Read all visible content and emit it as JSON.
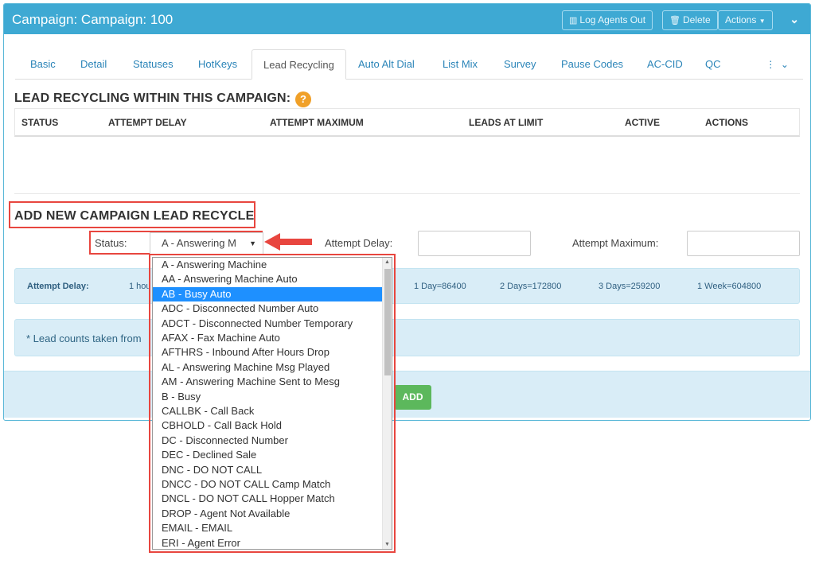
{
  "header": {
    "title": "Campaign: Campaign: 100",
    "log_agents_out": "Log Agents Out",
    "delete": "Delete",
    "actions": "Actions",
    "accent_color": "#3ea9d3"
  },
  "tabs": [
    {
      "label": "Basic",
      "active": false
    },
    {
      "label": "Detail",
      "active": false
    },
    {
      "label": "Statuses",
      "active": false
    },
    {
      "label": "HotKeys",
      "active": false
    },
    {
      "label": "Lead Recycling",
      "active": true
    },
    {
      "label": "Auto Alt Dial",
      "active": false
    },
    {
      "label": "List Mix",
      "active": false
    },
    {
      "label": "Survey",
      "active": false
    },
    {
      "label": "Pause Codes",
      "active": false
    },
    {
      "label": "AC-CID",
      "active": false
    },
    {
      "label": "QC",
      "active": false
    }
  ],
  "section1": {
    "title": "LEAD RECYCLING WITHIN THIS CAMPAIGN:",
    "help": "?",
    "columns": [
      "STATUS",
      "ATTEMPT DELAY",
      "ATTEMPT MAXIMUM",
      "LEADS AT LIMIT",
      "ACTIVE",
      "ACTIONS"
    ]
  },
  "section2": {
    "title": "ADD NEW CAMPAIGN LEAD RECYCLE",
    "status_label": "Status:",
    "status_value": "A - Answering M",
    "attempt_delay_label": "Attempt Delay:",
    "attempt_maximum_label": "Attempt Maximum:"
  },
  "info_bar": {
    "label": "Attempt Delay:",
    "visible_partial": "1 hou",
    "options": [
      "1 Day=86400",
      "2 Days=172800",
      "3 Days=259200",
      "1 Week=604800"
    ]
  },
  "note": {
    "text": "* Lead counts taken from"
  },
  "footer": {
    "add_label": "ADD"
  },
  "dropdown": {
    "selected_index": 2,
    "options": [
      "A - Answering Machine",
      "AA - Answering Machine Auto",
      "AB - Busy Auto",
      "ADC - Disconnected Number Auto",
      "ADCT - Disconnected Number Temporary",
      "AFAX - Fax Machine Auto",
      "AFTHRS - Inbound After Hours Drop",
      "AL - Answering Machine Msg Played",
      "AM - Answering Machine Sent to Mesg",
      "B - Busy",
      "CALLBK - Call Back",
      "CBHOLD - Call Back Hold",
      "DC - Disconnected Number",
      "DEC - Declined Sale",
      "DNC - DO NOT CALL",
      "DNCC - DO NOT CALL Camp Match",
      "DNCL - DO NOT CALL Hopper Match",
      "DROP - Agent Not Available",
      "EMAIL - EMAIL",
      "ERI - Agent Error"
    ]
  }
}
